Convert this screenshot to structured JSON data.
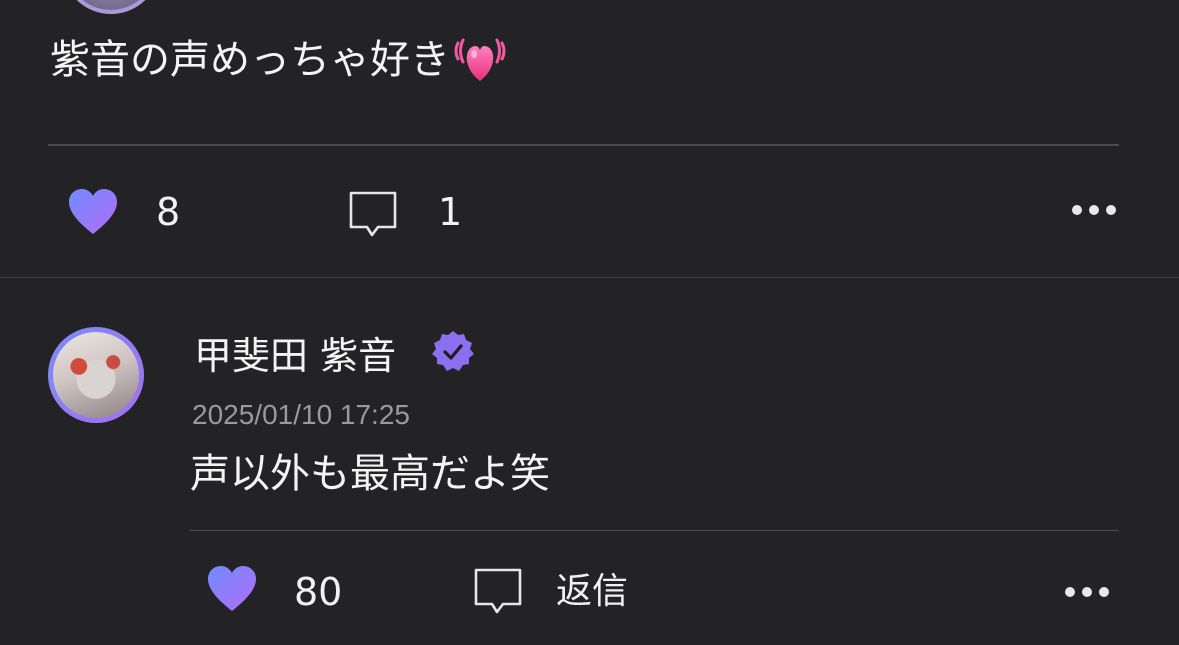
{
  "post": {
    "text": "紫音の声めっちゃ好き",
    "emoji": "growing-heart-emoji",
    "likes": "8",
    "comments": "1"
  },
  "reply": {
    "author": "甲斐田 紫音",
    "verified": true,
    "timestamp": "2025/01/10 17:25",
    "text": "声以外も最高だよ笑",
    "likes": "80",
    "reply_label": "返信"
  },
  "colors": {
    "background": "#232224",
    "heart_gradient_start": "#6f8cff",
    "heart_gradient_end": "#b46cf6",
    "verified_badge": "#8a6ff0",
    "timestamp": "#9a999c",
    "divider": "#4b4a4d"
  },
  "icons": {
    "like": "heart-icon",
    "comment": "speech-bubble-icon",
    "more": "more-dots-icon",
    "verified": "verified-badge-icon"
  }
}
